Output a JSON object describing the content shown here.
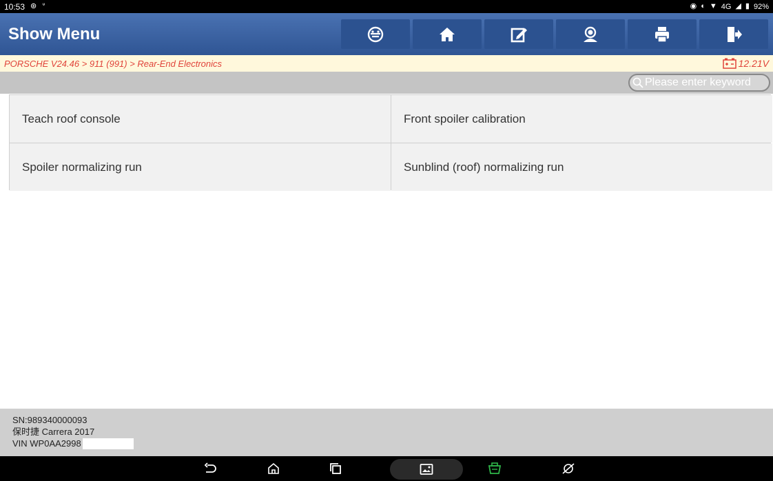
{
  "status_bar": {
    "time": "10:53",
    "network": "4G",
    "battery": "92%"
  },
  "header": {
    "title": "Show Menu",
    "buttons": [
      {
        "icon": "vehicle-icon"
      },
      {
        "icon": "home-icon"
      },
      {
        "icon": "edit-note-icon"
      },
      {
        "icon": "support-icon"
      },
      {
        "icon": "print-icon"
      },
      {
        "icon": "exit-icon"
      }
    ]
  },
  "breadcrumb": {
    "path": "PORSCHE V24.46 > 911 (991) > Rear-End Electronics",
    "voltage": "12.21V"
  },
  "search": {
    "placeholder": "Please enter keyword"
  },
  "menu": {
    "items": [
      "Teach roof console",
      "Front spoiler calibration",
      "Spoiler normalizing run",
      "Sunblind (roof) normalizing run"
    ]
  },
  "footer": {
    "sn": "SN:989340000093",
    "vehicle": "保时捷 Carrera 2017",
    "vin": "VIN WP0AA2998"
  },
  "colors": {
    "header_bg": "#3a64a8",
    "breadcrumb_text": "#e0433a",
    "breadcrumb_bg": "#fff8dc",
    "vci_green": "#2fb74a"
  }
}
